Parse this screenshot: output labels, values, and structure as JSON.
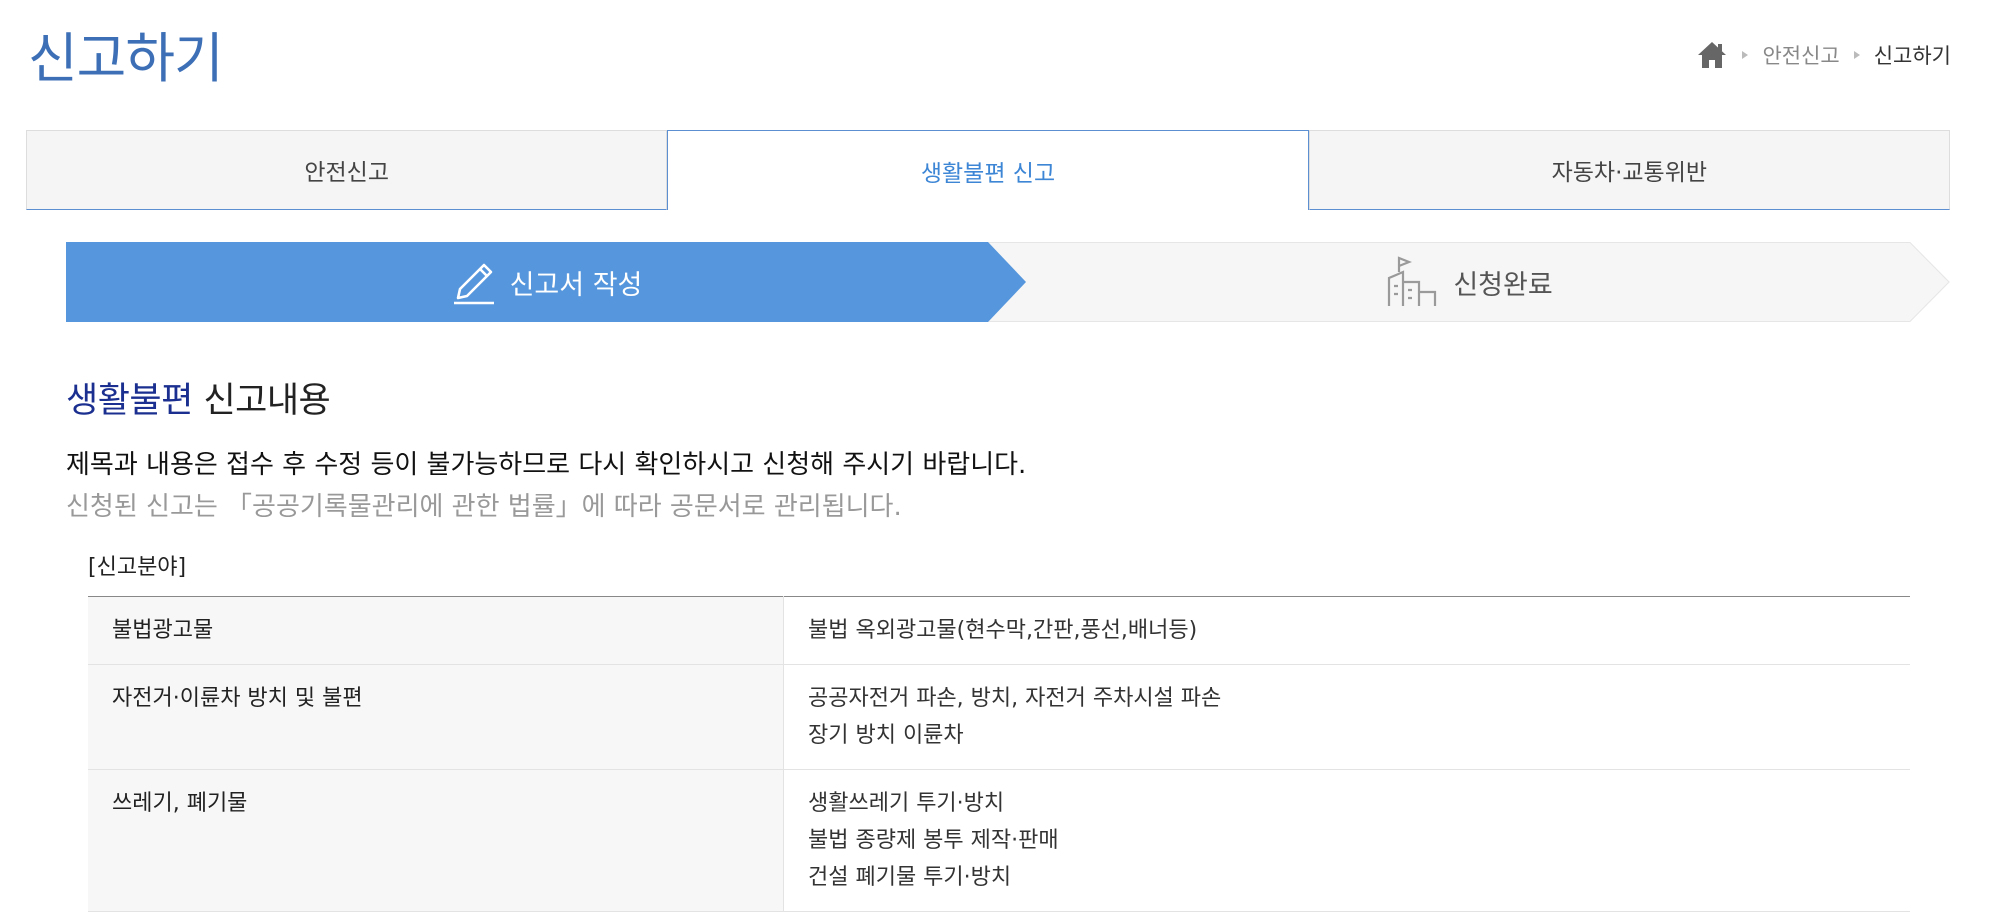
{
  "page": {
    "title": "신고하기"
  },
  "breadcrumb": {
    "items": [
      "안전신고",
      "신고하기"
    ]
  },
  "tabs": [
    {
      "label": "안전신고",
      "active": false
    },
    {
      "label": "생활불편 신고",
      "active": true
    },
    {
      "label": "자동차·교통위반",
      "active": false
    }
  ],
  "steps": [
    {
      "label": "신고서 작성",
      "icon": "pencil-icon",
      "active": true
    },
    {
      "label": "신청완료",
      "icon": "building-flag-icon",
      "active": false
    }
  ],
  "section": {
    "title_highlight": "생활불편",
    "title_rest": " 신고내용",
    "notice1": "제목과 내용은 접수 후 수정 등이 불가능하므로 다시 확인하시고 신청해 주시기 바랍니다.",
    "notice2": "신청된 신고는 「공공기록물관리에 관한 법률」에 따라 공문서로 관리됩니다.",
    "category_label": "[신고분야]"
  },
  "categories": [
    {
      "name": "불법광고물",
      "details": [
        "불법 옥외광고물(현수막,간판,풍선,배너등)"
      ]
    },
    {
      "name": "자전거·이륜차 방치 및 불편",
      "details": [
        "공공자전거 파손, 방치, 자전거 주차시설 파손",
        "장기 방치 이륜차"
      ]
    },
    {
      "name": "쓰레기, 폐기물",
      "details": [
        "생활쓰레기 투기·방치",
        "불법 종량제 봉투 제작·판매",
        "건설 폐기물 투기·방치"
      ]
    }
  ],
  "colors": {
    "title": "#3c6fb6",
    "active_tab": "#3d86d6",
    "step_active": "#5596dc",
    "highlight": "#1a2f8f"
  }
}
